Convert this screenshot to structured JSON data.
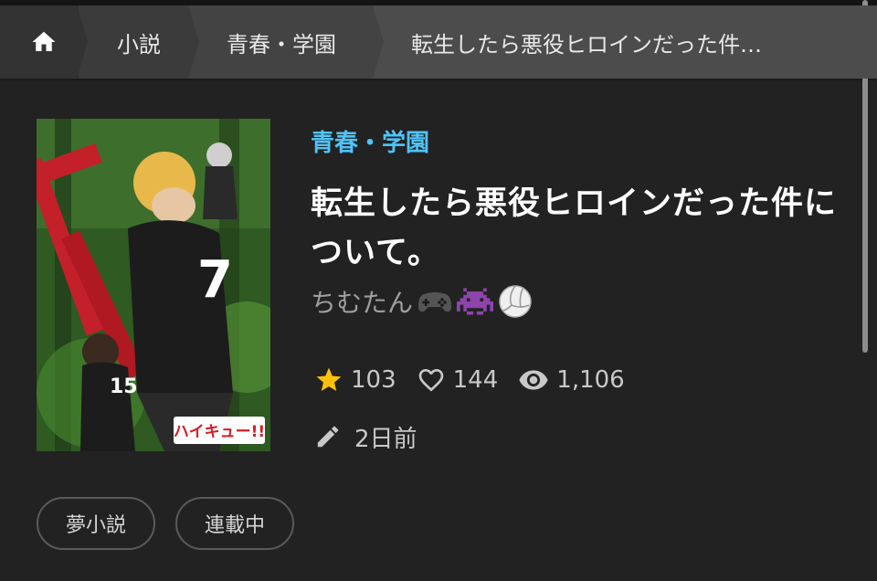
{
  "breadcrumb": {
    "home_icon": "home-icon",
    "items": [
      "小説",
      "青春・学園",
      "転生したら悪役ヒロインだった件…"
    ]
  },
  "cover": {
    "alt": "haikyuu-style-cover",
    "logo_text": "ハイキュー!!",
    "jersey_numbers": [
      "7",
      "15"
    ]
  },
  "novel": {
    "genre": "青春・学園",
    "title": "転生したら悪役ヒロインだった件について。",
    "author": "ちむたん",
    "author_emojis": [
      "game-controller-icon",
      "space-invader-icon",
      "volleyball-icon"
    ]
  },
  "stats": {
    "stars": "103",
    "likes": "144",
    "views": "1,106"
  },
  "updated": "2日前",
  "tags": [
    "夢小説",
    "連載中"
  ],
  "colors": {
    "background": "#222222",
    "genre_accent": "#4fc3f7",
    "star": "#ffc107"
  }
}
